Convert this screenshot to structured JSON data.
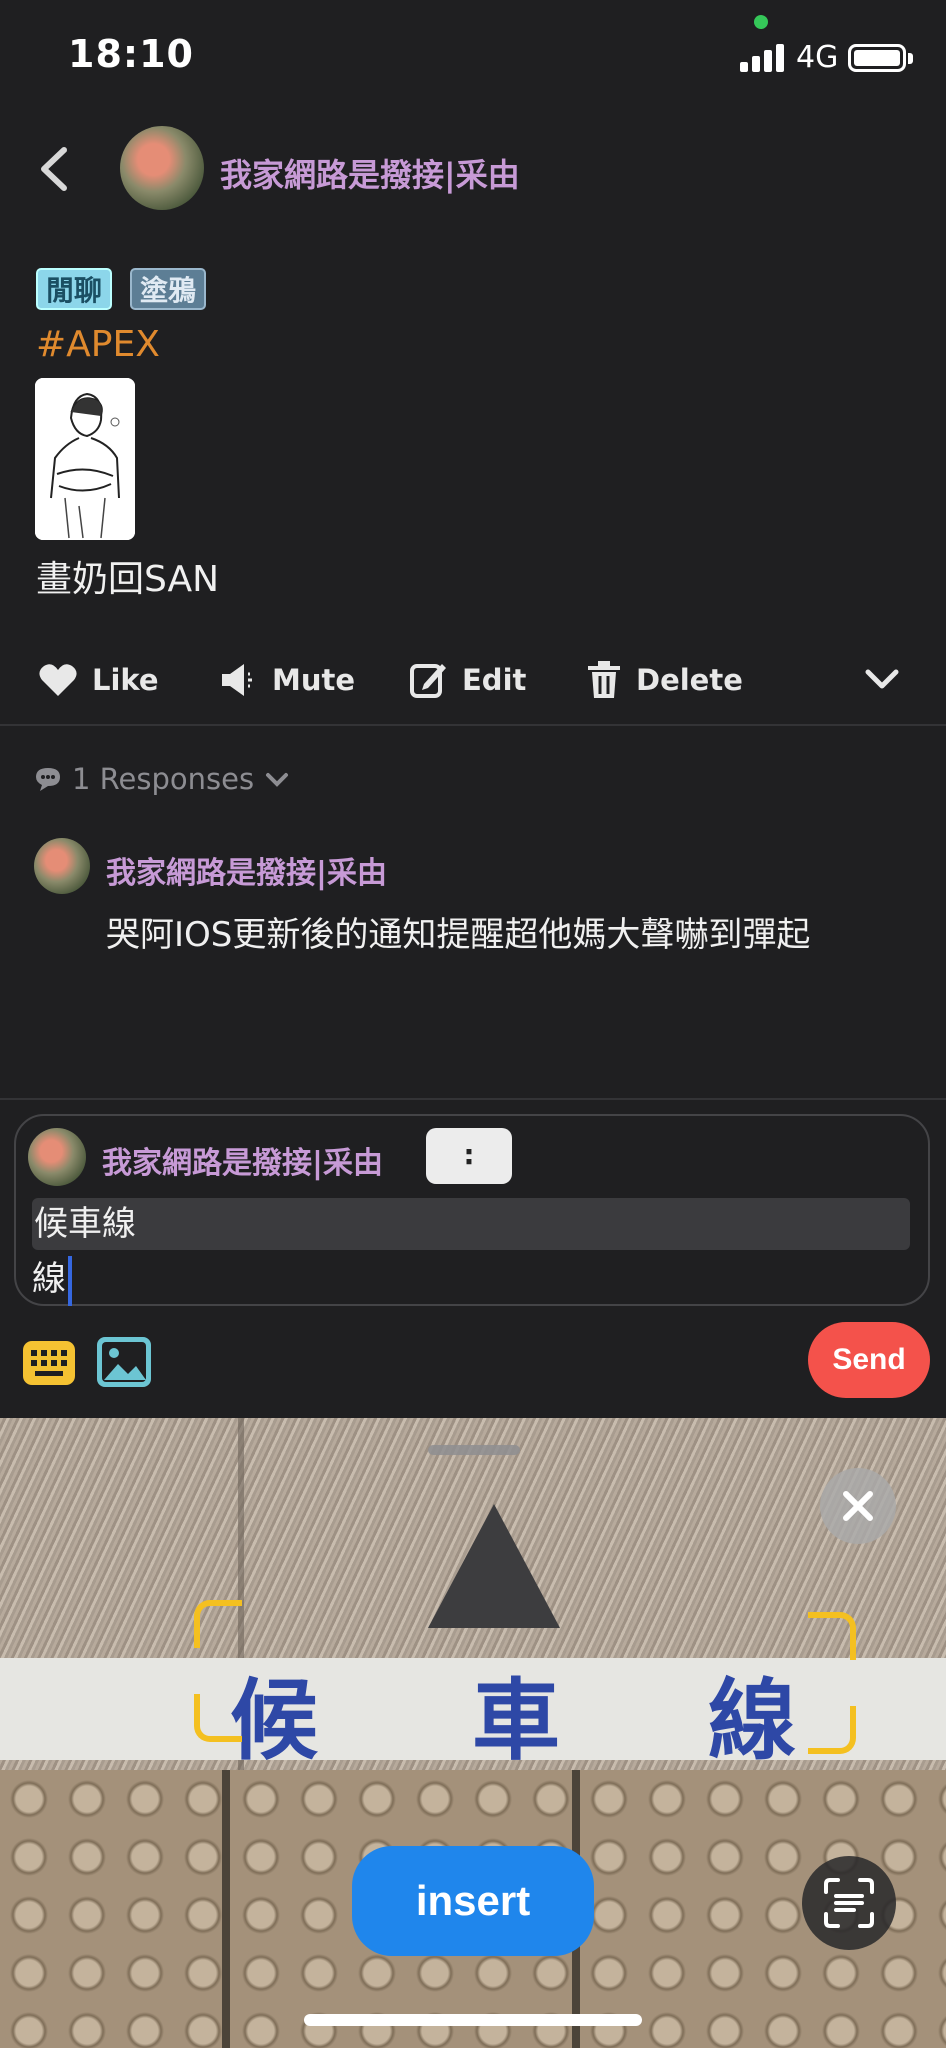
{
  "status_bar": {
    "time": "18:10",
    "network": "4G"
  },
  "header": {
    "username": "我家網路是撥接|采由"
  },
  "post": {
    "tags": [
      "閒聊",
      "塗鴉"
    ],
    "hashtag": "#APEX",
    "text": "畫奶回SAN"
  },
  "actions": {
    "like": "Like",
    "mute": "Mute",
    "edit": "Edit",
    "delete": "Delete"
  },
  "responses": {
    "label": "1 Responses",
    "items": [
      {
        "username": "我家網路是撥接|采由",
        "text": "哭阿IOS更新後的通知提醒超他媽大聲嚇到彈起"
      }
    ]
  },
  "composer": {
    "username": "我家網路是撥接|采由",
    "mention_chip": ":",
    "line1": "候車線",
    "line2": "線",
    "send_label": "Send"
  },
  "live_text": {
    "recognized_chars": [
      "候",
      "車",
      "線"
    ],
    "insert_label": "insert"
  },
  "colors": {
    "accent_name": "#c79ad6",
    "hashtag": "#e08a2e",
    "send": "#f4524b",
    "insert": "#1f86ec",
    "bracket": "#f4c020"
  }
}
